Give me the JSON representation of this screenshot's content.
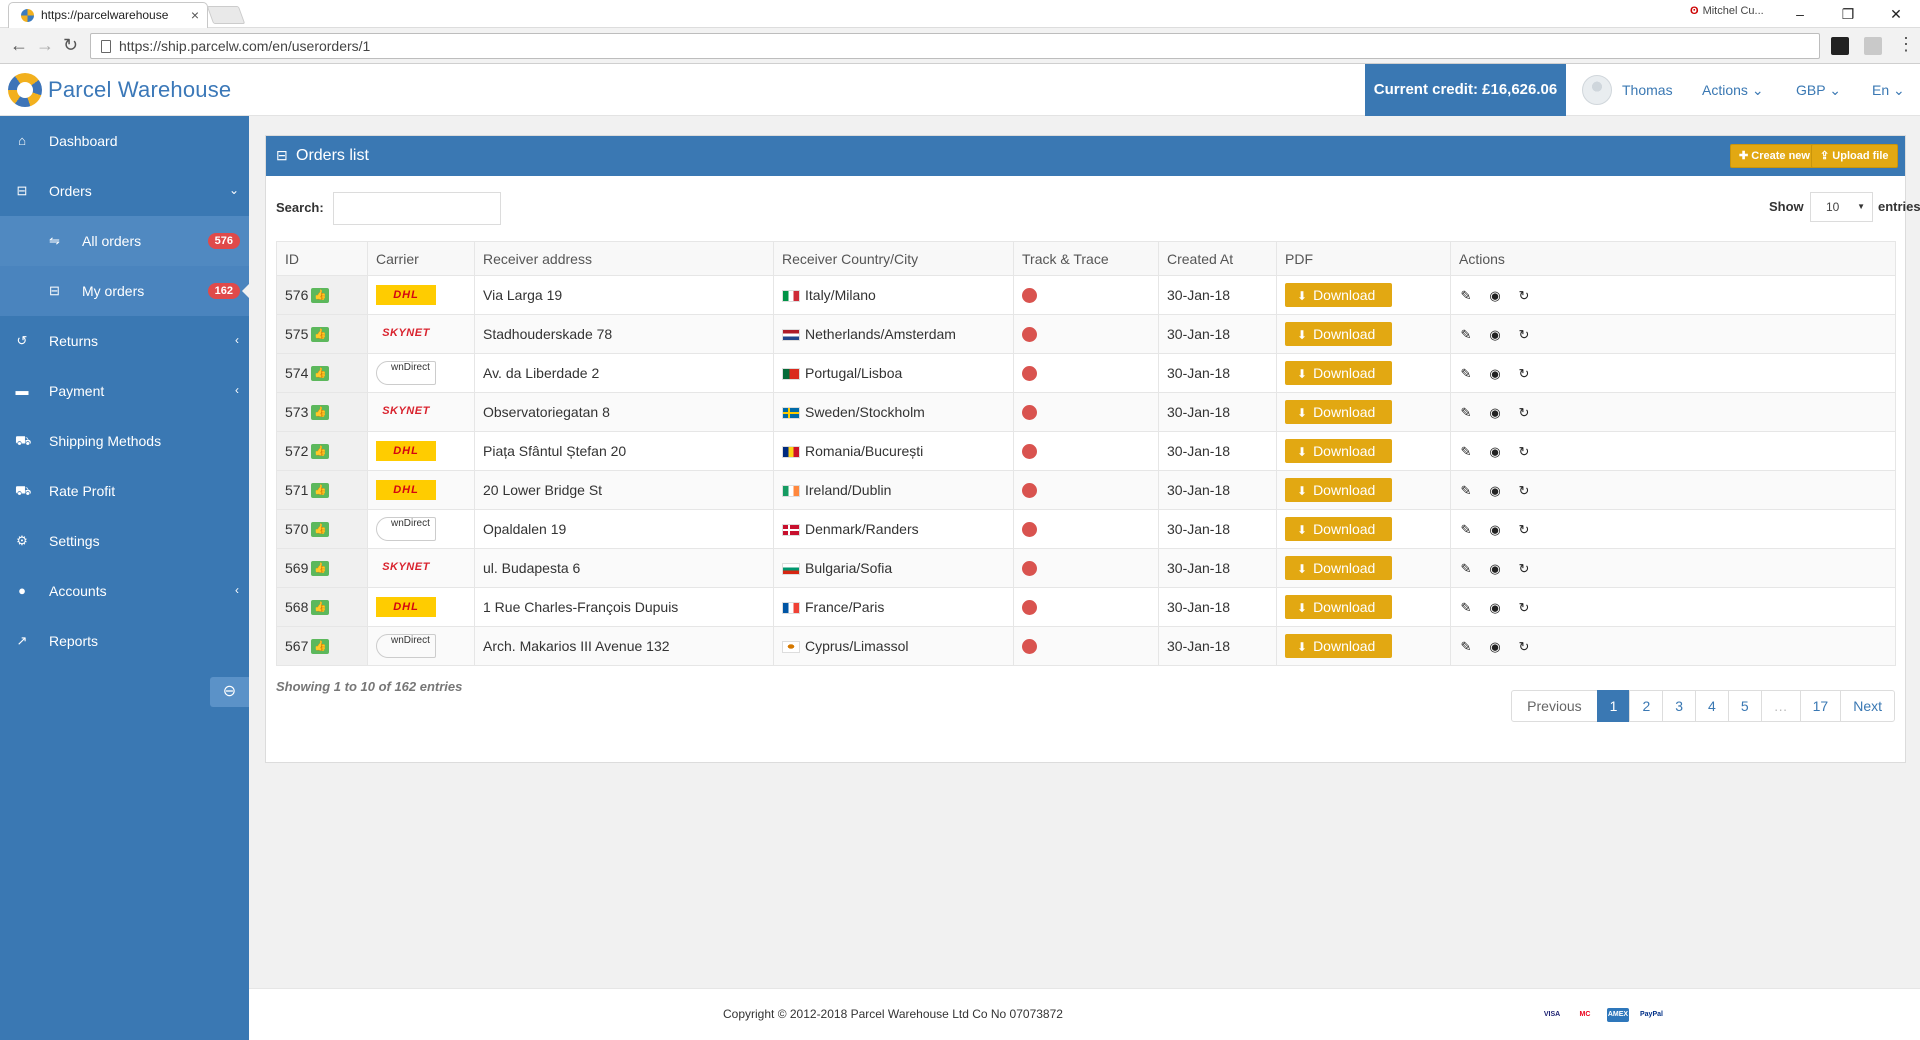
{
  "browser": {
    "tab_title": "https://parcelwarehouse",
    "profile_label": "Mitchel Cu...",
    "url": "https://ship.parcelw.com/en/userorders/1"
  },
  "header": {
    "logo_part1": "Parcel",
    "logo_part2": "Warehouse",
    "credit": "Current credit: £16,626.06",
    "user_name": "Thomas",
    "actions_label": "Actions",
    "currency_label": "GBP",
    "language_label": "En"
  },
  "sidebar": {
    "dashboard": "Dashboard",
    "orders": "Orders",
    "all_orders": "All orders",
    "all_orders_count": "576",
    "my_orders": "My orders",
    "my_orders_count": "162",
    "returns": "Returns",
    "payment": "Payment",
    "shipping_methods": "Shipping Methods",
    "rate_profit": "Rate Profit",
    "settings": "Settings",
    "accounts": "Accounts",
    "reports": "Reports"
  },
  "panel": {
    "title": "Orders list",
    "create_new": "Create new",
    "upload_file": "Upload file",
    "search_label": "Search:",
    "search_value": "",
    "show_label": "Show",
    "show_value": "10",
    "entries_label": "entries"
  },
  "table": {
    "columns": [
      "ID",
      "Carrier",
      "Receiver address",
      "Receiver Country/City",
      "Track & Trace",
      "Created At",
      "PDF",
      "Actions"
    ],
    "download_label": "Download",
    "rows": [
      {
        "id": "576",
        "carrier": "DHL",
        "address": "Via Larga 19",
        "country": "Italy/Milano",
        "flag": "it",
        "created": "30-Jan-18"
      },
      {
        "id": "575",
        "carrier": "SKYNET",
        "address": "Stadhouderskade 78",
        "country": "Netherlands/Amsterdam",
        "flag": "nl",
        "created": "30-Jan-18"
      },
      {
        "id": "574",
        "carrier": "DOWNDIRECT",
        "address": "Av. da Liberdade 2",
        "country": "Portugal/Lisboa",
        "flag": "pt",
        "created": "30-Jan-18"
      },
      {
        "id": "573",
        "carrier": "SKYNET",
        "address": "Observatoriegatan 8",
        "country": "Sweden/Stockholm",
        "flag": "se",
        "created": "30-Jan-18"
      },
      {
        "id": "572",
        "carrier": "DHL",
        "address": "Piața Sfântul Ștefan 20",
        "country": "Romania/București",
        "flag": "ro",
        "created": "30-Jan-18"
      },
      {
        "id": "571",
        "carrier": "DHL",
        "address": "20 Lower Bridge St",
        "country": "Ireland/Dublin",
        "flag": "ie",
        "created": "30-Jan-18"
      },
      {
        "id": "570",
        "carrier": "DOWNDIRECT",
        "address": "Opaldalen 19",
        "country": "Denmark/Randers",
        "flag": "dk",
        "created": "30-Jan-18"
      },
      {
        "id": "569",
        "carrier": "SKYNET",
        "address": "ul. Budapesta 6",
        "country": "Bulgaria/Sofia",
        "flag": "bg",
        "created": "30-Jan-18"
      },
      {
        "id": "568",
        "carrier": "DHL",
        "address": "1 Rue Charles-François Dupuis",
        "country": "France/Paris",
        "flag": "fr",
        "created": "30-Jan-18"
      },
      {
        "id": "567",
        "carrier": "DOWNDIRECT",
        "address": "Arch. Makarios III Avenue 132",
        "country": "Cyprus/Limassol",
        "flag": "cy",
        "created": "30-Jan-18"
      }
    ]
  },
  "carriers": {
    "dhl_text": "DHL",
    "skynet_text": "SKYNET",
    "down_text": "wnDirect"
  },
  "pagination": {
    "info": "Showing 1 to 10 of 162 entries",
    "previous": "Previous",
    "pages": [
      "1",
      "2",
      "3",
      "4",
      "5",
      "…",
      "17"
    ],
    "active_page": "1",
    "next": "Next"
  },
  "footer": {
    "copyright": "Copyright © 2012-2018 Parcel Warehouse Ltd Co No 07073872",
    "payments": [
      "VISA",
      "MC",
      "AMEX",
      "PayPal"
    ]
  },
  "colors": {
    "brand_blue": "#3a78b3",
    "accent_yellow": "#e2a812",
    "badge_red": "#e04a4a",
    "status_green": "#5cb85c",
    "track_red": "#d9534f"
  }
}
